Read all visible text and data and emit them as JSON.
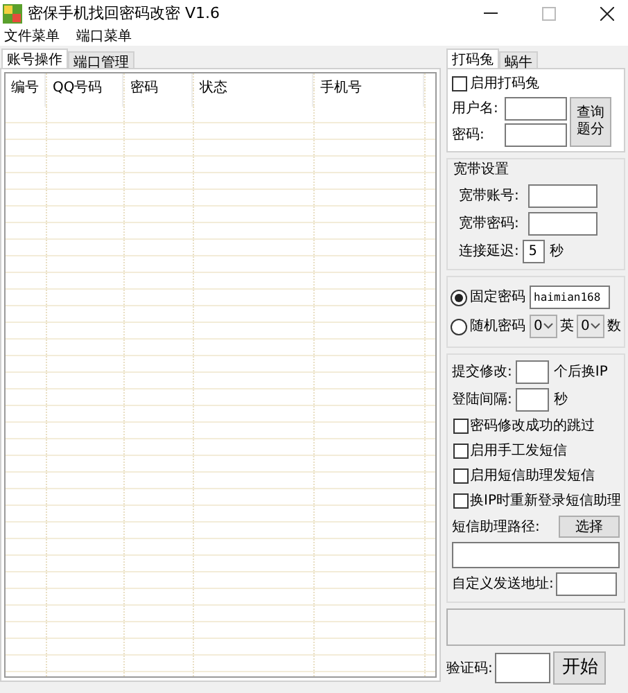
{
  "window": {
    "title": "密保手机找回密码改密 V1.6"
  },
  "menu": [
    "文件菜单",
    "端口菜单"
  ],
  "left_tabs": [
    {
      "label": "账号操作",
      "selected": true
    },
    {
      "label": "端口管理",
      "selected": false
    }
  ],
  "table": {
    "columns": [
      "编号",
      "QQ号码",
      "密码",
      "状态",
      "手机号"
    ]
  },
  "right_tabs": [
    {
      "label": "打码兔",
      "selected": true
    },
    {
      "label": "蜗牛",
      "selected": false
    }
  ],
  "dama": {
    "enable": {
      "label": "启用打码兔",
      "checked": false
    },
    "username_label": "用户名:",
    "password_label": "密码:",
    "query_button": "查询题分"
  },
  "broadband": {
    "title": "宽带设置",
    "account_label": "宽带账号:",
    "password_label": "宽带密码:",
    "delay_label": "连接延迟:",
    "delay_value": "5",
    "delay_unit": "秒"
  },
  "password_mode": [
    {
      "kind": "fixed",
      "label": "固定密码",
      "selected": true,
      "value": "haimian168"
    },
    {
      "kind": "random",
      "label": "随机密码",
      "selected": false,
      "letters": "0",
      "letters_label": "英",
      "digits": "0",
      "digits_label": "数"
    }
  ],
  "settings": {
    "submit_label": "提交修改:",
    "submit_suffix": "个后换IP",
    "interval_label": "登陆间隔:",
    "interval_unit": "秒",
    "options": [
      {
        "label": "密码修改成功的跳过",
        "checked": false
      },
      {
        "label": "启用手工发短信",
        "checked": false
      },
      {
        "label": "启用短信助理发短信",
        "checked": false
      },
      {
        "label": "换IP时重新登录短信助理",
        "checked": false
      }
    ],
    "sms_path_label": "短信助理路径:",
    "choose_button": "选择",
    "custom_address_label": "自定义发送地址:"
  },
  "captcha_label": "验证码:",
  "start_button": "开始"
}
